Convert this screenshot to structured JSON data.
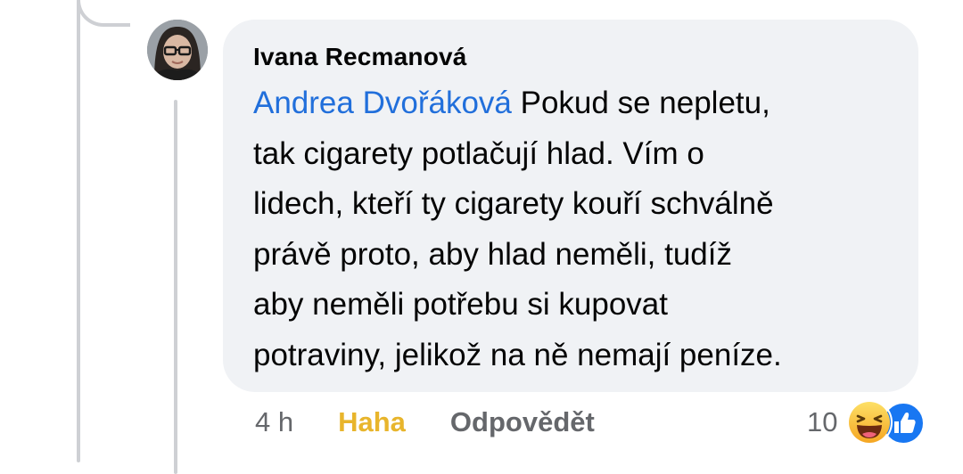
{
  "comment": {
    "author": "Ivana Recmanová",
    "mention": "Andrea Dvořáková",
    "lines": [
      " Pokud se nepletu,",
      "tak cigarety potlačují hlad. Vím o",
      "lidech, kteří ty cigarety kouří schválně",
      "právě proto, aby hlad neměli, tudíž",
      "aby neměli potřebu si kupovat",
      "potraviny, jelikož na ně nemají peníze."
    ]
  },
  "actions": {
    "time": "4 h",
    "reaction_label": "Haha",
    "reply_label": "Odpovědět"
  },
  "reactions": {
    "count": "10",
    "icons": [
      "haha-icon",
      "like-icon"
    ]
  },
  "colors": {
    "mention": "#216fdb",
    "haha": "#e8b52c",
    "bubble": "#f0f2f5",
    "like": "#1877f2"
  }
}
